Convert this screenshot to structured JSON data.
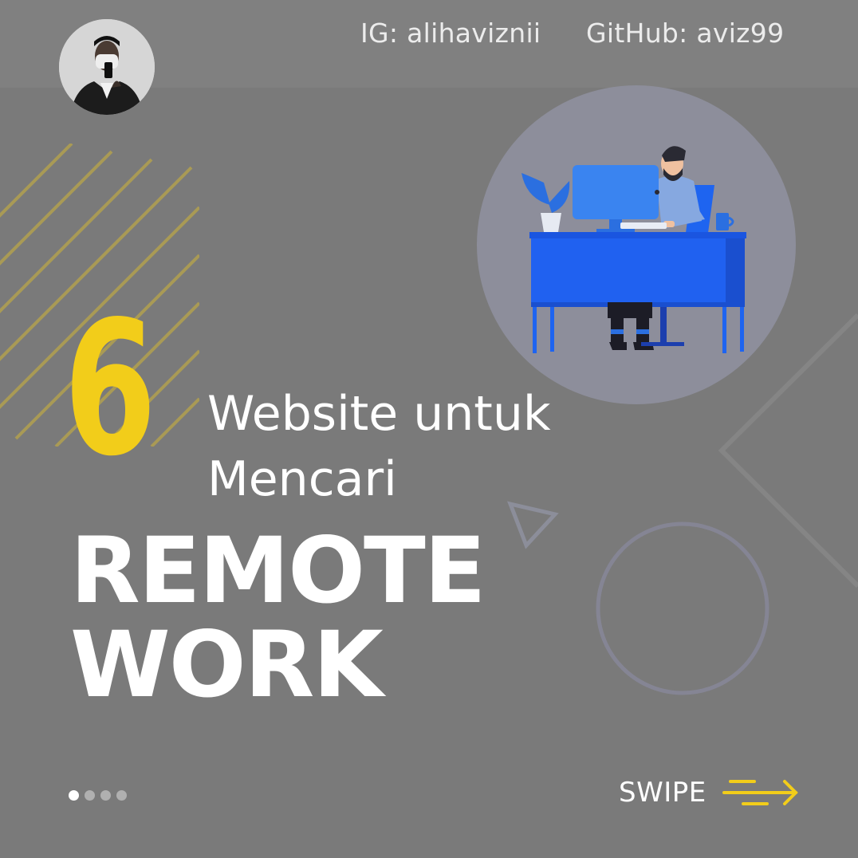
{
  "social": {
    "instagram": "IG: alihaviznii",
    "github": "GitHub: aviz99"
  },
  "headline": {
    "number": "6",
    "line1": "Website untuk",
    "line2": "Mencari",
    "title_line1": "REMOTE",
    "title_line2": "WORK"
  },
  "pager": {
    "total": 4,
    "current": 1
  },
  "swipe": {
    "label": "SWIPE"
  },
  "colors": {
    "background": "#7a7a7a",
    "accent_yellow": "#f2cd1a",
    "illustration_blue": "#1e64f0",
    "text": "#ffffff"
  },
  "icons": [
    "avatar-photo",
    "stripes-decoration",
    "remote-worker-illustration",
    "triangle-outline",
    "circle-outline",
    "swipe-arrow-icon"
  ]
}
